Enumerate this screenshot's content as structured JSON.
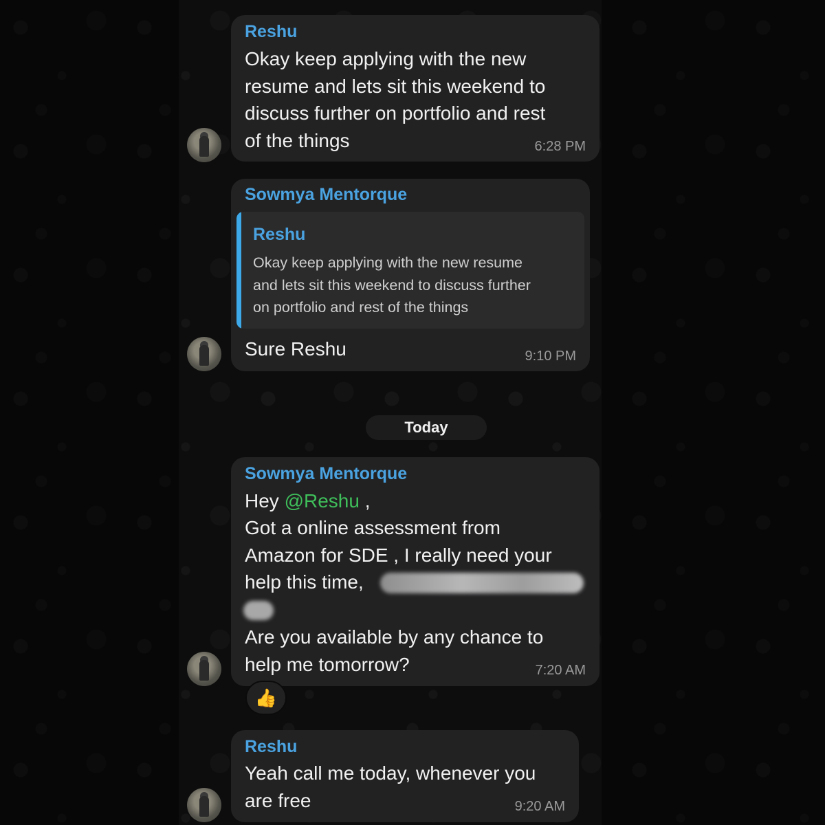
{
  "day_separator": "Today",
  "messages": [
    {
      "sender": "Reshu",
      "text": "Okay keep applying with the new\nresume and lets sit this weekend to\ndiscuss further on portfolio and rest\nof the things",
      "time": "6:28 PM"
    },
    {
      "sender": "Sowmya Mentorque",
      "quote": {
        "sender": "Reshu",
        "text": "Okay keep applying with the new resume\nand lets sit this weekend to discuss further\non portfolio and rest of the things"
      },
      "text": "Sure Reshu",
      "time": "9:10 PM"
    },
    {
      "sender": "Sowmya Mentorque",
      "text_hey": "Hey",
      "mention": "@Reshu",
      "text_after_mention": ",",
      "text_line2": "Got a online assessment from\nAmazon for SDE , I really need your\nhelp this time,",
      "text_line3": "Are you available by any chance to\nhelp me tomorrow?",
      "time": "7:20 AM",
      "reaction": "👍"
    },
    {
      "sender": "Reshu",
      "text": "Yeah call me today, whenever you\nare free",
      "time": "9:20 AM"
    }
  ],
  "colors": {
    "sender_name": "#4aa3e0",
    "mention": "#3fbf5a",
    "bubble": "#222223",
    "quote_bar": "#3ea9e8"
  }
}
